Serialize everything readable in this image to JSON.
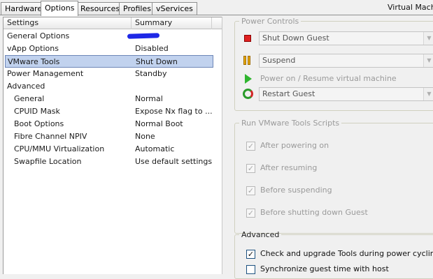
{
  "tabs": [
    "Hardware",
    "Options",
    "Resources",
    "Profiles",
    "vServices"
  ],
  "active_tab": "Options",
  "window_title": "Virtual Machine",
  "columns": {
    "settings": "Settings",
    "summary": "Summary"
  },
  "settings_rows": [
    {
      "name": "General Options",
      "summary": ""
    },
    {
      "name": "vApp Options",
      "summary": "Disabled"
    },
    {
      "name": "VMware Tools",
      "summary": "Shut Down"
    },
    {
      "name": "Power Management",
      "summary": "Standby"
    },
    {
      "name": "Advanced",
      "summary": ""
    },
    {
      "name": "General",
      "summary": "Normal"
    },
    {
      "name": "CPUID Mask",
      "summary": "Expose Nx flag to ..."
    },
    {
      "name": "Boot Options",
      "summary": "Normal Boot"
    },
    {
      "name": "Fibre Channel NPIV",
      "summary": "None"
    },
    {
      "name": "CPU/MMU Virtualization",
      "summary": "Automatic"
    },
    {
      "name": "Swapfile Location",
      "summary": "Use default settings"
    }
  ],
  "power_controls": {
    "title": "Power Controls",
    "shutdown": "Shut Down Guest",
    "suspend": "Suspend",
    "power_on_label": "Power on / Resume virtual machine",
    "restart": "Restart Guest"
  },
  "scripts": {
    "title": "Run VMware Tools Scripts",
    "after_powering_on": "After powering on",
    "after_resuming": "After resuming",
    "before_suspending": "Before suspending",
    "before_shutting_down": "Before shutting down Guest"
  },
  "advanced": {
    "title": "Advanced",
    "check_upgrade": "Check and upgrade Tools during power cycling",
    "sync_time": "Synchronize guest time with host"
  },
  "glyphs": {
    "check": "✓",
    "dropdown_arrow": "▼"
  },
  "colors": {
    "selection": "#c1d2ee",
    "scribble": "#1e28e6"
  }
}
